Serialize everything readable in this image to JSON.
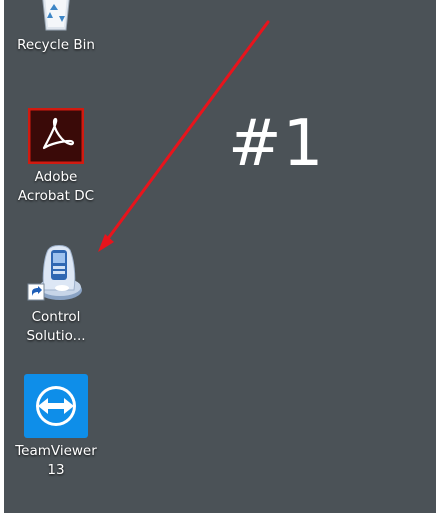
{
  "desktop": {
    "background": "#4b5257",
    "icons": [
      {
        "id": "recycle-bin",
        "label": "Recycle Bin",
        "icon": "recycle-bin-icon"
      },
      {
        "id": "adobe",
        "label_line1": "Adobe",
        "label_line2": "Acrobat DC",
        "icon": "adobe-acrobat-icon",
        "accent": "#b30b00"
      },
      {
        "id": "control",
        "label_line1": "Control",
        "label_line2": "Solutio...",
        "icon": "control-solutions-icon",
        "has_shortcut_overlay": true
      },
      {
        "id": "teamviewer",
        "label_line1": "TeamViewer",
        "label_line2": "13",
        "icon": "teamviewer-icon",
        "accent": "#0e8ee9"
      }
    ]
  },
  "annotation": {
    "text": "#1",
    "arrow_color": "#e8141c",
    "arrow_icon": "arrow-annotation"
  }
}
